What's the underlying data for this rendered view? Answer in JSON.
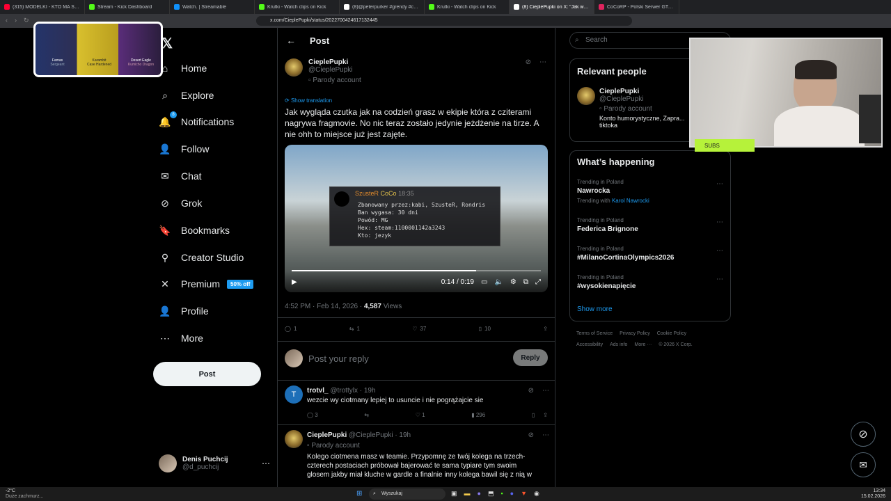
{
  "browser": {
    "tabs": [
      {
        "title": "(315) MODELKI - KTO MA STYL ...",
        "color": "#ff0033"
      },
      {
        "title": "Stream - Kick Dashboard",
        "color": "#53fc18"
      },
      {
        "title": "Watch. | Streamable",
        "color": "#0f90fa"
      },
      {
        "title": "Krutki - Watch clips on Kick",
        "color": "#53fc18"
      },
      {
        "title": "(8)@peterpurker #grendy #cocorp #...",
        "color": "#ffffff"
      },
      {
        "title": "Krutki - Watch clips on Kick",
        "color": "#53fc18"
      },
      {
        "title": "(8) CieplePupki on X: \"Jak wygląd...",
        "color": "#ffffff"
      },
      {
        "title": "CoCoRP - Polski Serwer GTA RP Whi...",
        "color": "#e0245e"
      }
    ],
    "url": "x.com/CieplePupki/status/2022700424617132445"
  },
  "nav": {
    "logo": "𝕏",
    "items": [
      {
        "label": "Home",
        "icon": "home-icon",
        "glyph": "⌂"
      },
      {
        "label": "Explore",
        "icon": "search-icon",
        "glyph": "⌕"
      },
      {
        "label": "Notifications",
        "icon": "bell-icon",
        "glyph": "🔔"
      },
      {
        "label": "Follow",
        "icon": "person-plus-icon",
        "glyph": "👤"
      },
      {
        "label": "Chat",
        "icon": "mail-icon",
        "glyph": "✉"
      },
      {
        "label": "Grok",
        "icon": "grok-icon",
        "glyph": "⊘"
      },
      {
        "label": "Bookmarks",
        "icon": "bookmark-icon",
        "glyph": "🔖"
      },
      {
        "label": "Creator Studio",
        "icon": "creator-icon",
        "glyph": "⚲"
      },
      {
        "label": "Premium",
        "icon": "x-icon",
        "glyph": "✕"
      },
      {
        "label": "Profile",
        "icon": "profile-icon",
        "glyph": "👤"
      },
      {
        "label": "More",
        "icon": "more-icon",
        "glyph": "⋯"
      }
    ],
    "notification_count": "8",
    "premium_badge": "50% off",
    "post_button": "Post",
    "account": {
      "name": "Denis Puchcij",
      "handle": "@d_puchcij"
    }
  },
  "post": {
    "header": "Post",
    "author": "CieplePupki",
    "handle": "@CieplePupki",
    "parody": "Parody account",
    "show_translation": "Show translation",
    "text": "Jak wygląda czutka jak na codzień grasz w ekipie która z cziterami nagrywa fragmovie. No nic teraz zostało jedynie jeżdżenie na tirze. A nie ohh to miejsce już jest zajęte.",
    "video": {
      "overlay_name": "SzusteR",
      "overlay_tag": "CoCo",
      "overlay_time": "18:35",
      "overlay_lines": [
        "Zbanowany przez:kabi, SzusteR, Rondris",
        "Ban wygasa: 30 dni",
        "Powód: MG",
        "Hex: steam:1100001142a3243",
        "Kto: jezyk"
      ],
      "time": "0:14 / 0:19",
      "progress": 0.74
    },
    "timestamp": "4:52 PM · Feb 14, 2026 ·",
    "views_count": "4,587",
    "views_label": "Views",
    "stats": {
      "replies": "1",
      "reposts": "1",
      "likes": "37",
      "bookmarks": "10"
    },
    "reply_placeholder": "Post your reply",
    "reply_button": "Reply"
  },
  "replies": [
    {
      "name": "trotvl_",
      "handle": "@trottylx",
      "time": "· 19h",
      "avatar_letter": "T",
      "text": "wezcie wy ciotmany lepiej to usuncie i nie pogrążajcie sie",
      "stats": {
        "replies": "3",
        "reposts": "",
        "likes": "1",
        "views": "296"
      }
    },
    {
      "name": "CieplePupki",
      "handle": "@CieplePupki",
      "time": "· 19h",
      "parody": "Parody account",
      "text": "Kolego ciotmena masz w teamie. Przypomnę ze twój kolega na trzech-czterech postaciach próbował bajerować te sama typiare tym swoim glosem jakby miał kluche w gardle a finalnie inny kolega bawil się z nią w"
    }
  ],
  "sidebar": {
    "search_placeholder": "Search",
    "relevant_title": "Relevant people",
    "relevant": {
      "name": "CieplePupki",
      "handle": "@CieplePupki",
      "parody": "Parody account",
      "bio": "Konto humorystyczne, Zapra... tiktoka"
    },
    "happening_title": "What’s happening",
    "trends": [
      {
        "context": "Trending in Poland",
        "name": "Nawrocka",
        "with_label": "Trending with",
        "with": "Karol Nawrocki"
      },
      {
        "context": "Trending in Poland",
        "name": "Federica Brignone"
      },
      {
        "context": "Trending in Poland",
        "name": "#MilanoCortinaOlympics2026"
      },
      {
        "context": "Trending in Poland",
        "name": "#wysokienapięcie"
      }
    ],
    "show_more": "Show more",
    "footer1": [
      "Terms of Service",
      "Privacy Policy",
      "Cookie Policy"
    ],
    "footer2": [
      "Accessibility",
      "Ads info",
      "More ···",
      "© 2026 X Corp."
    ]
  },
  "stream": {
    "subs_label": "SUBS",
    "overlay_items": [
      "Famas",
      "Karambit",
      "Desert Eagle"
    ],
    "overlay_subs": [
      "Sergeant",
      "Case Hardened",
      "Kumicho Dragon"
    ]
  },
  "taskbar": {
    "weather": "-2°C",
    "weather_sub": "Duże zachmurz...",
    "search": "Wyszukaj",
    "time": "13:34",
    "date": "15.02.2026"
  }
}
